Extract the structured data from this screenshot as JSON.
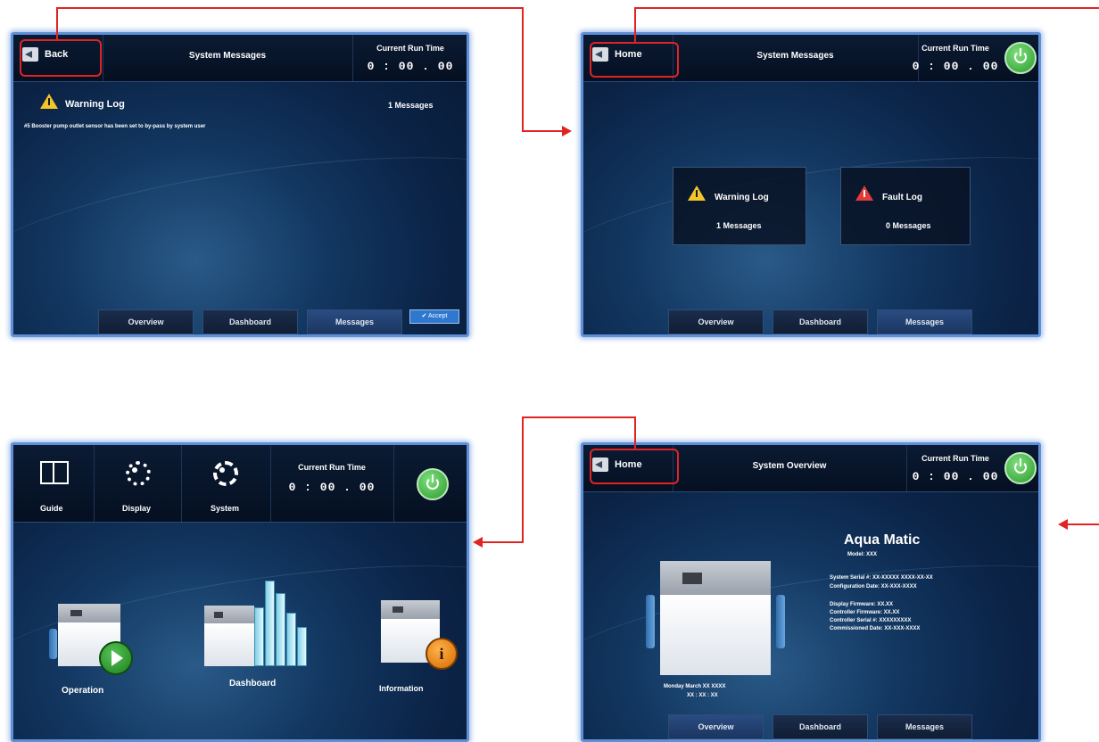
{
  "common": {
    "run_time_label": "Current Run Time",
    "run_time_value_a": "0 : 00 . 00",
    "run_time_value_b": "0 : 00 . 00",
    "tab_overview": "Overview",
    "tab_dashboard": "Dashboard",
    "tab_messages": "Messages"
  },
  "screen_warning": {
    "back_label": "Back",
    "title": "System Messages",
    "log_title": "Warning Log",
    "count": "1 Messages",
    "message": "#5 Booster pump outlet sensor has been set to by-pass by system user",
    "accept_label": "Accept"
  },
  "screen_messages": {
    "home_label": "Home",
    "title": "System Messages",
    "warning_log": "Warning Log",
    "warning_count": "1  Messages",
    "fault_log": "Fault Log",
    "fault_count": "0  Messages"
  },
  "screen_home": {
    "guide": "Guide",
    "display": "Display",
    "system": "System",
    "operation": "Operation",
    "dashboard": "Dashboard",
    "information": "Information"
  },
  "screen_overview": {
    "home_label": "Home",
    "title": "System Overview",
    "product": "Aqua Matic",
    "model": "Model:   XXX",
    "details": [
      "System Serial #:  XX-XXXXX   XXXX-XX-XX",
      "Configuration Date:  XX-XXX-XXXX",
      "Display Firmware:  XX.XX",
      "Controller Firmware:  XX.XX",
      "Controller Serial #:  XXXXXXXXX",
      "Commissioned Date:  XX-XXX-XXXX"
    ],
    "date_line": "Monday      March    XX   XXXX",
    "time_line": "XX : XX : XX"
  }
}
